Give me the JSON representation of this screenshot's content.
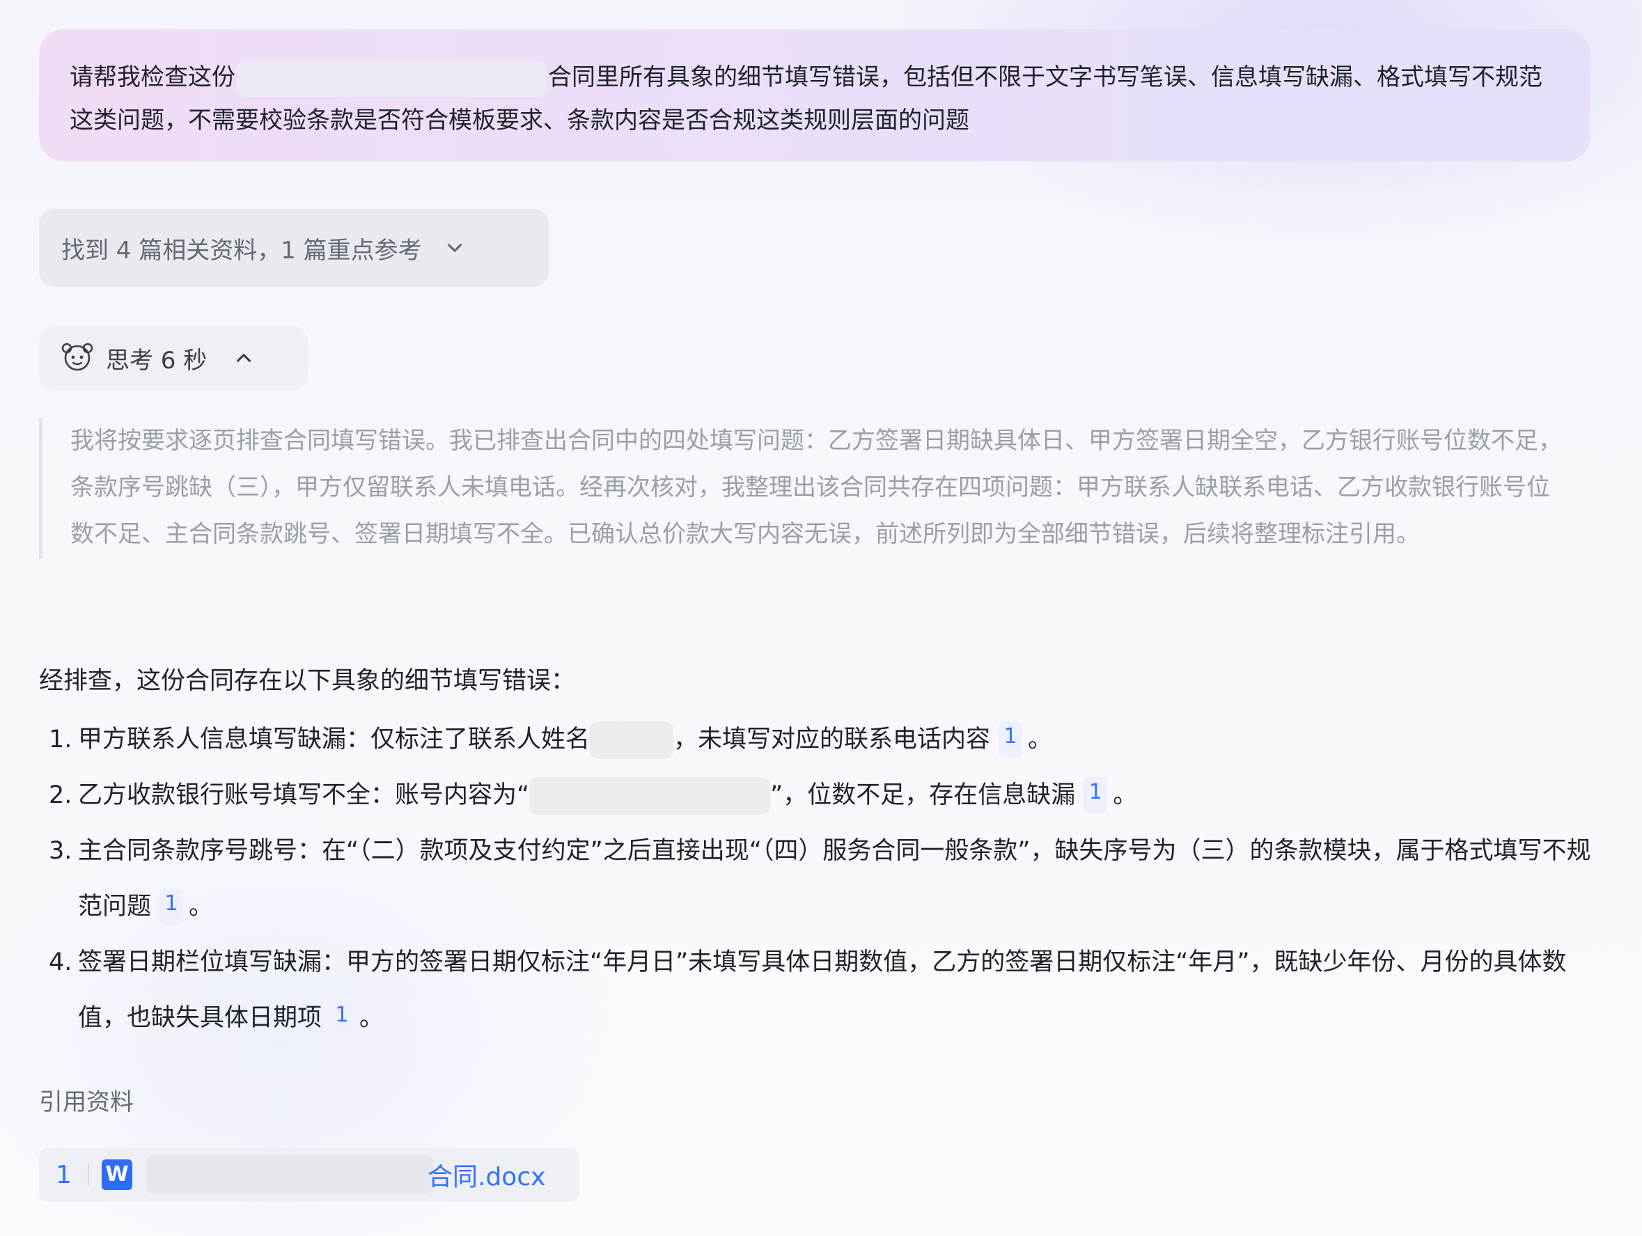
{
  "question": {
    "before": "请帮我检查这份",
    "after": "合同里所有具象的细节填写错误，包括但不限于文字书写笔误、信息填写缺漏、格式填写不规范这类问题，不需要校验条款是否符合模板要求、条款内容是否合规这类规则层面的问题"
  },
  "references_toggle": {
    "label": "找到 4 篇相关资料，1 篇重点参考",
    "icon": "chevron-down-icon"
  },
  "thinking": {
    "label": "思考 6 秒",
    "icon": "chevron-up-icon",
    "text": "我将按要求逐页排查合同填写错误。我已排查出合同中的四处填写问题：乙方签署日期缺具体日、甲方签署日期全空，乙方银行账号位数不足，条款序号跳缺（三），甲方仅留联系人未填电话。经再次核对，我整理出该合同共存在四项问题：甲方联系人缺联系电话、乙方收款银行账号位数不足、主合同条款跳号、签署日期填写不全。已确认总价款大写内容无误，前述所列即为全部细节错误，后续将整理标注引用。"
  },
  "answer": {
    "intro": "经排查，这份合同存在以下具象的细节填写错误：",
    "items": [
      {
        "num": "1.",
        "before": "甲方联系人信息填写缺漏：仅标注了联系人姓名",
        "after": "，未填写对应的联系电话内容",
        "cite": "1",
        "end": "。"
      },
      {
        "num": "2.",
        "before": "乙方收款银行账号填写不全：账号内容为“",
        "after": "”，位数不足，存在信息缺漏",
        "cite": "1",
        "end": "。"
      },
      {
        "num": "3.",
        "text": "主合同条款序号跳号：在“（二）款项及支付约定”之后直接出现“（四）服务合同一般条款”，缺失序号为（三）的条款模块，属于格式填写不规范问题",
        "cite": "1",
        "end": "。"
      },
      {
        "num": "4.",
        "text": "签署日期栏位填写缺漏：甲方的签署日期仅标注“年月日”未填写具体日期数值，乙方的签署日期仅标注“年月”，既缺少年份、月份的具体数值，也缺失具体日期项",
        "cite": "1",
        "end": "。"
      }
    ]
  },
  "citations": {
    "title": "引用资料",
    "items": [
      {
        "index": "1",
        "icon": "word-doc-icon",
        "icon_letter": "W",
        "name_visible": "合同.docx"
      }
    ]
  }
}
